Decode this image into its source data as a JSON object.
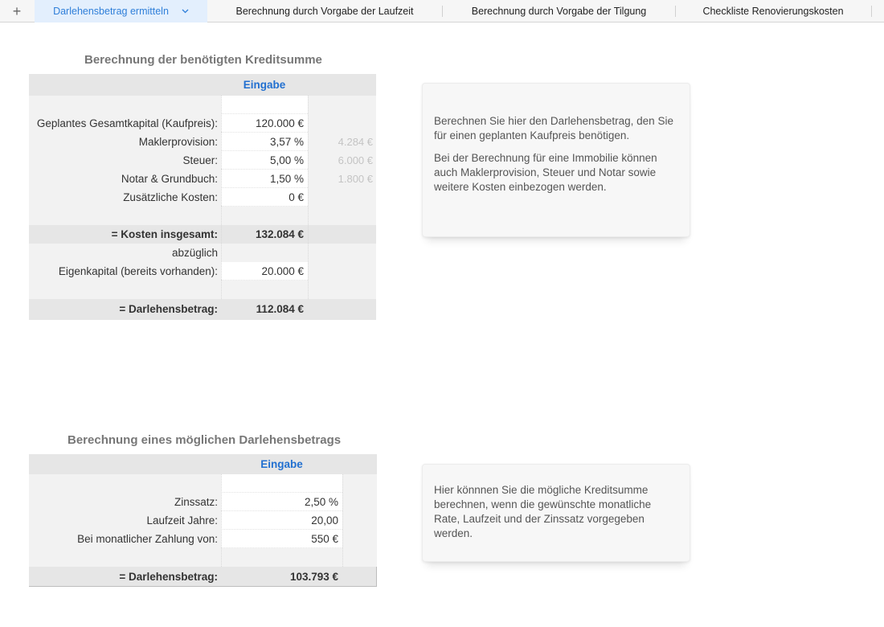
{
  "tabs": {
    "add_symbol": "+",
    "items": [
      {
        "label": "Darlehensbetrag ermitteln",
        "active": true
      },
      {
        "label": "Berechnung durch Vorgabe der Laufzeit",
        "active": false
      },
      {
        "label": "Berechnung durch Vorgabe der Tilgung",
        "active": false
      },
      {
        "label": "Checkliste Renovierungskosten",
        "active": false
      }
    ],
    "dropdown_icon": "chevron-down-icon"
  },
  "section1": {
    "title": "Berechnung der benötigten Kreditsumme",
    "header": "Eingabe",
    "rows": {
      "kaufpreis": {
        "label": "Geplantes Gesamtkapital (Kaufpreis):",
        "value": "120.000 €"
      },
      "makler": {
        "label": "Maklerprovision:",
        "value": "3,57 %",
        "calc": "4.284 €"
      },
      "steuer": {
        "label": "Steuer:",
        "value": "5,00 %",
        "calc": "6.000 €"
      },
      "notar": {
        "label": "Notar & Grundbuch:",
        "value": "1,50 %",
        "calc": "1.800 €"
      },
      "zusatz": {
        "label": "Zusätzliche Kosten:",
        "value": "0 €"
      },
      "kosten": {
        "label": "= Kosten insgesamt:",
        "value": "132.084 €"
      },
      "abzueglich": {
        "label": "abzüglich"
      },
      "eigenkapital": {
        "label": "Eigenkapital (bereits vorhanden):",
        "value": "20.000 €"
      },
      "darlehen": {
        "label": "= Darlehensbetrag:",
        "value": "112.084 €"
      }
    },
    "info": [
      "Berechnen Sie hier den Darlehensbetrag, den Sie für einen geplanten Kaufpreis benötigen.",
      "Bei der Berechnung für eine Immobilie können auch Maklerprovision, Steuer und Notar sowie weitere Kosten einbezogen werden."
    ]
  },
  "section2": {
    "title": "Berechnung eines möglichen Darlehensbetrags",
    "header": "Eingabe",
    "rows": {
      "zinssatz": {
        "label": "Zinssatz:",
        "value": "2,50 %"
      },
      "laufzeit": {
        "label": "Laufzeit Jahre:",
        "value": "20,00"
      },
      "rate": {
        "label": "Bei monatlicher Zahlung von:",
        "value": "550 €"
      },
      "darlehen": {
        "label": "= Darlehensbetrag:",
        "value": "103.793 €"
      }
    },
    "info": [
      "Hier könnnen Sie die mögliche Kreditsumme berechnen, wenn die gewünschte monatliche Rate, Laufzeit und der Zinssatz vorgegeben werden."
    ]
  }
}
